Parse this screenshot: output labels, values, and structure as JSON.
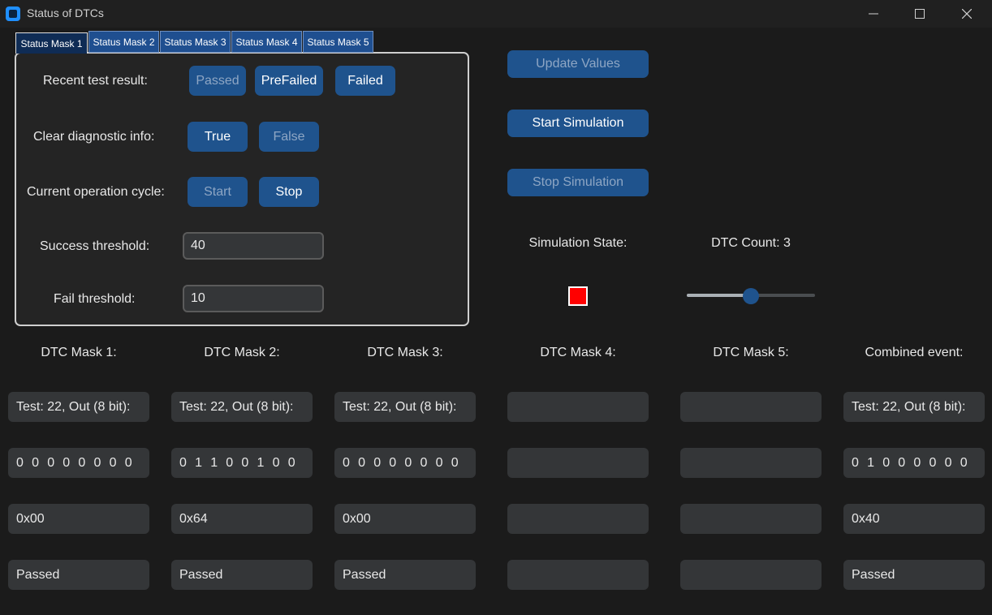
{
  "window": {
    "title": "Status of DTCs",
    "controls": [
      "minimize-icon",
      "maximize-icon",
      "close-icon"
    ]
  },
  "tabs": [
    {
      "label": "Status Mask 1",
      "active": true
    },
    {
      "label": "Status Mask 2",
      "active": false
    },
    {
      "label": "Status Mask 3",
      "active": false
    },
    {
      "label": "Status Mask 4",
      "active": false
    },
    {
      "label": "Status Mask 5",
      "active": false
    }
  ],
  "form": {
    "recent_test_result": {
      "label": "Recent test result:",
      "options": [
        "Passed",
        "PreFailed",
        "Failed"
      ],
      "selected": "Passed"
    },
    "clear_diagnostic_info": {
      "label": "Clear diagnostic info:",
      "options": [
        "True",
        "False"
      ],
      "selected": "False"
    },
    "current_operation_cycle": {
      "label": "Current operation cycle:",
      "options": [
        "Start",
        "Stop"
      ],
      "selected": "Start"
    },
    "success_threshold": {
      "label": "Success threshold:",
      "value": "40"
    },
    "fail_threshold": {
      "label": "Fail threshold:",
      "value": "10"
    }
  },
  "actions": {
    "update_values": "Update Values",
    "start_simulation": "Start Simulation",
    "stop_simulation": "Stop Simulation"
  },
  "simulation": {
    "state_label": "Simulation State:",
    "state_color": "#ff0000",
    "dtc_count_label": "DTC Count: 3",
    "dtc_count_slider_fraction": 0.5
  },
  "columns": [
    {
      "header": "DTC Mask 1:",
      "test": "Test: 22, Out (8 bit):",
      "bits": "0 0 0 0 0 0 0 0",
      "hex": "0x00",
      "status": "Passed"
    },
    {
      "header": "DTC Mask 2:",
      "test": "Test: 22, Out (8 bit):",
      "bits": "0 1 1 0 0 1 0 0",
      "hex": "0x64",
      "status": "Passed"
    },
    {
      "header": "DTC Mask 3:",
      "test": "Test: 22, Out (8 bit):",
      "bits": "0 0 0 0 0 0 0 0",
      "hex": "0x00",
      "status": "Passed"
    },
    {
      "header": "DTC Mask 4:",
      "test": "",
      "bits": "",
      "hex": "",
      "status": ""
    },
    {
      "header": "DTC Mask 5:",
      "test": "",
      "bits": "",
      "hex": "",
      "status": ""
    },
    {
      "header": "Combined event:",
      "test": "Test: 22, Out (8 bit):",
      "bits": "0 1 0 0 0 0 0 0",
      "hex": "0x40",
      "status": "Passed"
    }
  ],
  "colors": {
    "accent": "#1f538d",
    "field_bg": "#343638",
    "window_bg": "#1b1b1b"
  }
}
